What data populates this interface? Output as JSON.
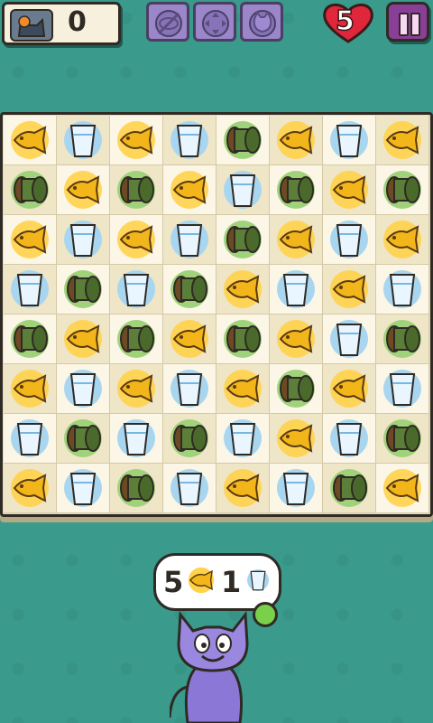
{
  "hud": {
    "score": "0",
    "lives": "5",
    "boosters": [
      "shuffle-booster",
      "swap-booster",
      "cat-booster"
    ]
  },
  "board": {
    "rows": [
      [
        "fish",
        "water",
        "fish",
        "water",
        "thread",
        "fish",
        "water",
        "fish"
      ],
      [
        "thread",
        "fish",
        "thread",
        "fish",
        "water",
        "thread",
        "fish",
        "thread"
      ],
      [
        "fish",
        "water",
        "fish",
        "water",
        "thread",
        "fish",
        "water",
        "fish"
      ],
      [
        "water",
        "thread",
        "water",
        "thread",
        "fish",
        "water",
        "fish",
        "water"
      ],
      [
        "thread",
        "fish",
        "thread",
        "fish",
        "thread",
        "fish",
        "water",
        "thread"
      ],
      [
        "fish",
        "water",
        "fish",
        "water",
        "fish",
        "thread",
        "fish",
        "water"
      ],
      [
        "water",
        "thread",
        "water",
        "thread",
        "water",
        "fish",
        "water",
        "thread"
      ],
      [
        "fish",
        "water",
        "thread",
        "water",
        "fish",
        "water",
        "thread",
        "fish"
      ]
    ]
  },
  "goal": {
    "fish_count": "5",
    "water_count": "1"
  },
  "colors": {
    "background": "#3a9a8c",
    "fish": "#f2b61a",
    "water_bg": "#a8d6f0",
    "thread": "#5b7f38"
  }
}
